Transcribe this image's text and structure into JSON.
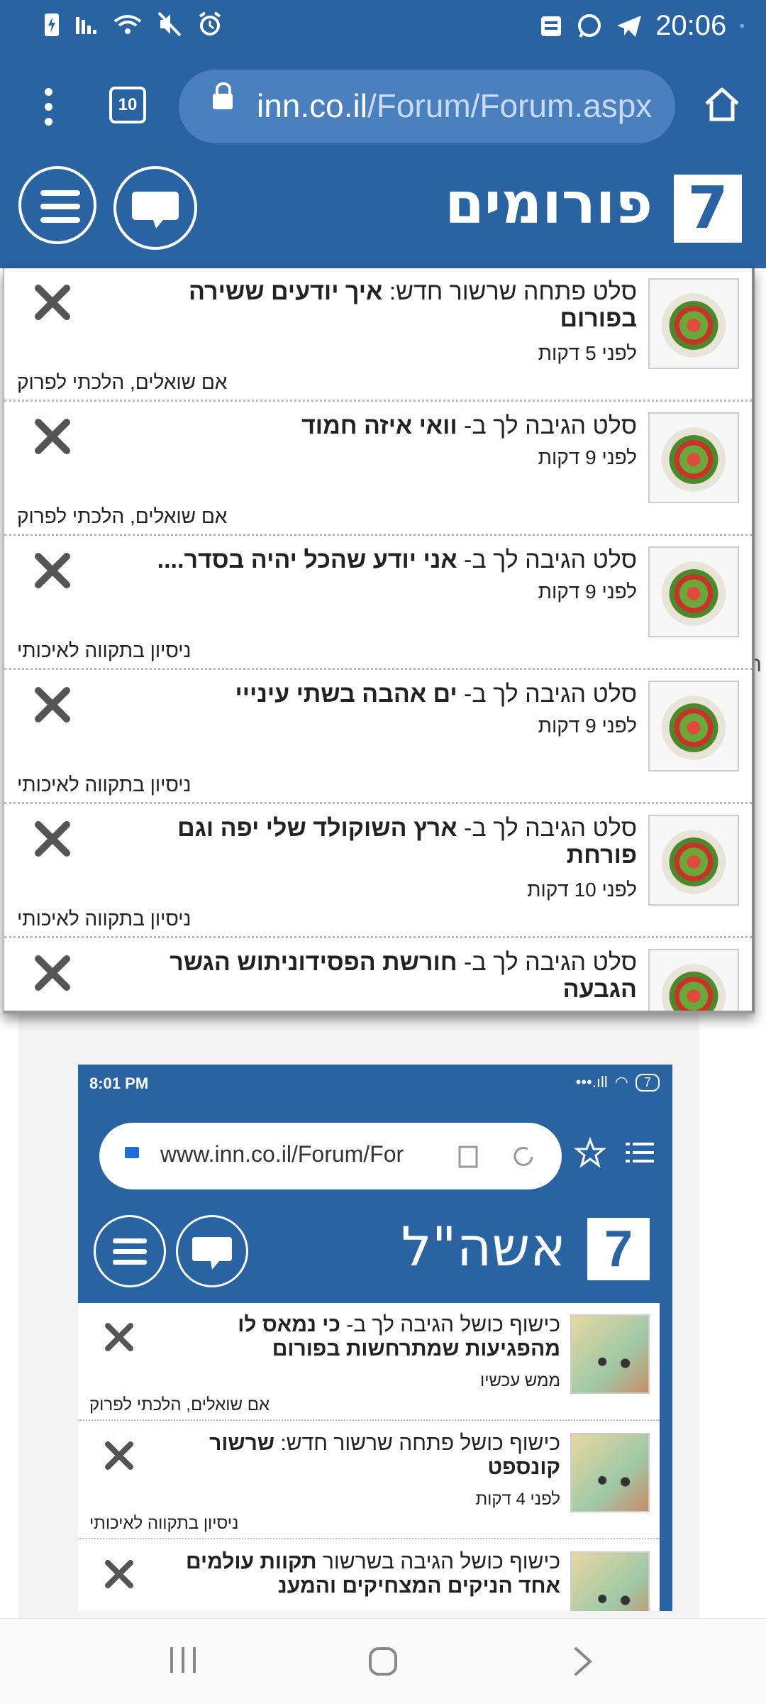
{
  "status_bar": {
    "time": "20:06",
    "left_icons": [
      "battery-charging-icon",
      "signal-icon",
      "wifi-icon",
      "mute-icon",
      "alarm-icon"
    ],
    "right_icons": [
      "notification-icon",
      "whatsapp-icon",
      "telegram-icon"
    ]
  },
  "browser": {
    "tabs_count": "10",
    "url_host": "inn.co.il",
    "url_path": "/Forum/Forum.aspx"
  },
  "site": {
    "title": "פורומים",
    "logo": "7"
  },
  "notifications": [
    {
      "prefix": "סלט פתחה שרשור חדש: ",
      "title": "איך יודעים ששירה בפורום",
      "time": "לפני 5 דקות",
      "forum": "אם שואלים, הלכתי לפרוק"
    },
    {
      "prefix": "סלט הגיבה לך ב- ",
      "title": "וואי איזה חמוד",
      "time": "לפני 9 דקות",
      "forum": "אם שואלים, הלכתי לפרוק"
    },
    {
      "prefix": "סלט הגיבה לך ב- ",
      "title": "אני יודע שהכל יהיה בסדר....",
      "time": "לפני 9 דקות",
      "forum": "ניסיון בתקווה לאיכותי"
    },
    {
      "prefix": "סלט הגיבה לך ב- ",
      "title": "ים אהבה בשתי עינייי",
      "time": "לפני 9 דקות",
      "forum": "ניסיון בתקווה לאיכותי"
    },
    {
      "prefix": "סלט הגיבה לך ב- ",
      "title": "ארץ השוקולד שלי יפה וגם פורחת",
      "time": "לפני 10 דקות",
      "forum": "ניסיון בתקווה לאיכותי"
    },
    {
      "prefix": "סלט הגיבה לך ב- ",
      "title": "חורשת הפסידוניתוש הגשר הגבעה",
      "time": "",
      "forum": ""
    }
  ],
  "edge_text": "ר",
  "embedded": {
    "time": "8:01 PM",
    "battery": "7",
    "url": "www.inn.co.il/Forum/For",
    "title": "אשה\"ל",
    "logo": "7",
    "items": [
      {
        "prefix": "כישוף כושל הגיבה לך ב- ",
        "title": "כי נמאס לו מהפגיעות שמתרחשות בפורום",
        "time": "ממש עכשיו",
        "forum": "אם שואלים, הלכתי לפרוק"
      },
      {
        "prefix": "כישוף כושל פתחה שרשור חדש: ",
        "title": "שרשור קונספט",
        "time": "לפני 4 דקות",
        "forum": "ניסיון בתקווה לאיכותי"
      },
      {
        "prefix": "כישוף כושל הגיבה בשרשור ",
        "title": "תקוות עולמים אחד הניקים המצחיקים והמענ",
        "time": "",
        "forum": ""
      }
    ]
  }
}
